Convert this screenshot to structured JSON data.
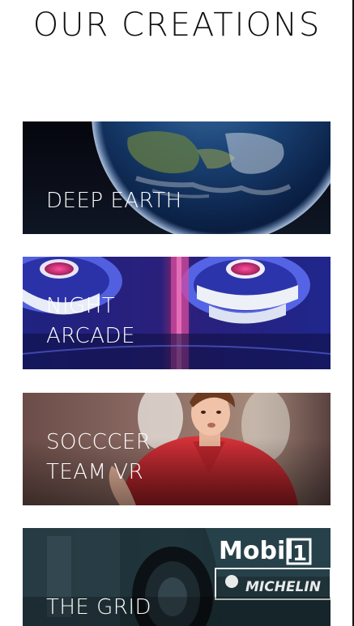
{
  "page": {
    "title": "OUR CREATIONS"
  },
  "colors": {
    "background": "#ffffff",
    "title": "#111111",
    "label": "#ffffff"
  },
  "creations": [
    {
      "label": "DEEP EARTH",
      "image": "earth-from-space"
    },
    {
      "label": "NIGHT\nARCADE",
      "image": "arcade-skee-ball"
    },
    {
      "label": "SOCCCER\nTEAM VR",
      "image": "soccer-player"
    },
    {
      "label": "THE GRID",
      "image": "race-car"
    }
  ]
}
